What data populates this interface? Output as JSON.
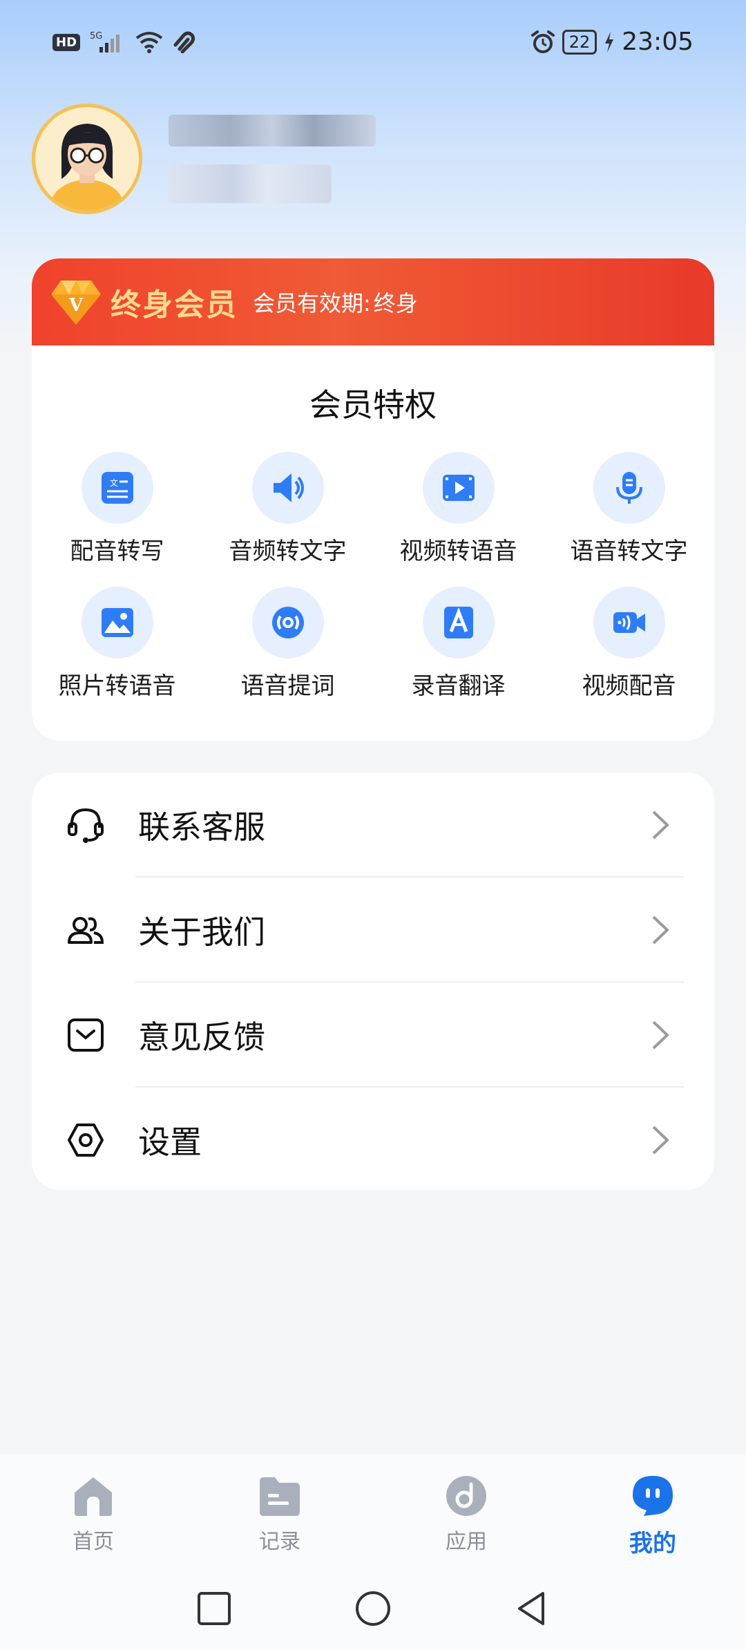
{
  "status_bar": {
    "network_hd": "HD",
    "network_gen": "5G",
    "battery": "22",
    "time": "23:05",
    "icons": [
      "signal-icon",
      "wifi-icon",
      "link-icon",
      "alarm-icon",
      "battery-icon",
      "charging-icon"
    ]
  },
  "profile": {
    "avatar_icon": "user-avatar-icon"
  },
  "membership": {
    "title": "终身会员",
    "expiry_label": "会员有效期:",
    "expiry_value": "终身",
    "privileges_title": "会员特权",
    "privileges": [
      {
        "label": "配音转写",
        "icon": "transcribe-icon"
      },
      {
        "label": "音频转文字",
        "icon": "speaker-icon"
      },
      {
        "label": "视频转语音",
        "icon": "video-icon"
      },
      {
        "label": "语音转文字",
        "icon": "microphone-icon"
      },
      {
        "label": "照片转语音",
        "icon": "image-icon"
      },
      {
        "label": "语音提词",
        "icon": "broadcast-icon"
      },
      {
        "label": "录音翻译",
        "icon": "translate-icon"
      },
      {
        "label": "视频配音",
        "icon": "video-camera-icon"
      }
    ]
  },
  "menu": {
    "items": [
      {
        "label": "联系客服",
        "icon": "headset-icon"
      },
      {
        "label": "关于我们",
        "icon": "users-icon"
      },
      {
        "label": "意见反馈",
        "icon": "feedback-icon"
      },
      {
        "label": "设置",
        "icon": "settings-icon"
      }
    ]
  },
  "bottom_nav": {
    "items": [
      {
        "label": "首页",
        "icon": "home-icon",
        "active": false
      },
      {
        "label": "记录",
        "icon": "folder-icon",
        "active": false
      },
      {
        "label": "应用",
        "icon": "apps-icon",
        "active": false
      },
      {
        "label": "我的",
        "icon": "profile-bubble-icon",
        "active": true
      }
    ]
  },
  "colors": {
    "accent": "#1b73e8",
    "vip_banner": "#f0422c",
    "vip_gold": "#ffd98e",
    "icon_blue": "#2f7df5"
  }
}
